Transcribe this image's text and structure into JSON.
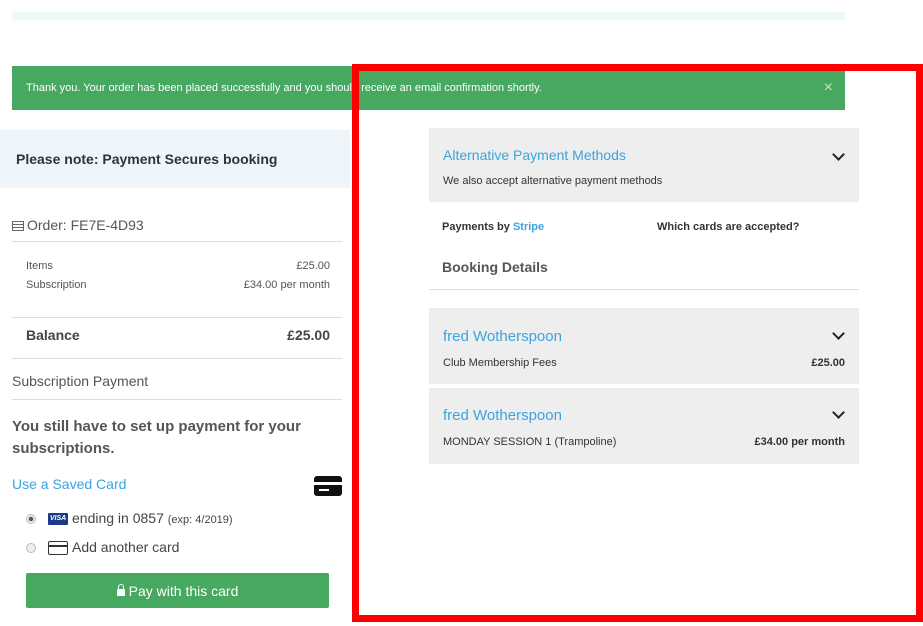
{
  "alert": {
    "message": "Thank you. Your order has been placed successfully and you should receive an email confirmation shortly.",
    "close": "×"
  },
  "note": "Please note: Payment Secures booking",
  "order": {
    "label": "Order: FE7E-4D93",
    "items_label": "Items",
    "items_value": "£25.00",
    "subscription_label": "Subscription",
    "subscription_value": "£34.00 per month",
    "balance_label": "Balance",
    "balance_value": "£25.00"
  },
  "subscription_payment": {
    "heading": "Subscription Payment",
    "notice": "You still have to set up payment for your subscriptions.",
    "saved_card_link": "Use a Saved Card",
    "card_brand": "VISA",
    "card_ending": "ending in 0857",
    "card_exp": "(exp: 4/2019)",
    "add_card": "Add another card",
    "pay_button": "Pay with this card"
  },
  "alt_payment": {
    "title": "Alternative Payment Methods",
    "subtitle": "We also accept alternative payment methods"
  },
  "payments_by": {
    "prefix": "Payments by",
    "provider": "Stripe",
    "cards_question": "Which cards are accepted?"
  },
  "booking": {
    "heading": "Booking Details",
    "items": [
      {
        "name": "fred Wotherspoon",
        "description": "Club Membership Fees",
        "amount": "£25.00"
      },
      {
        "name": "fred Wotherspoon",
        "description": "MONDAY SESSION 1 (Trampoline)",
        "amount": "£34.00 per month"
      }
    ]
  },
  "colors": {
    "success": "#46a95f",
    "link": "#3aa3e0",
    "highlight": "#ff0000"
  }
}
